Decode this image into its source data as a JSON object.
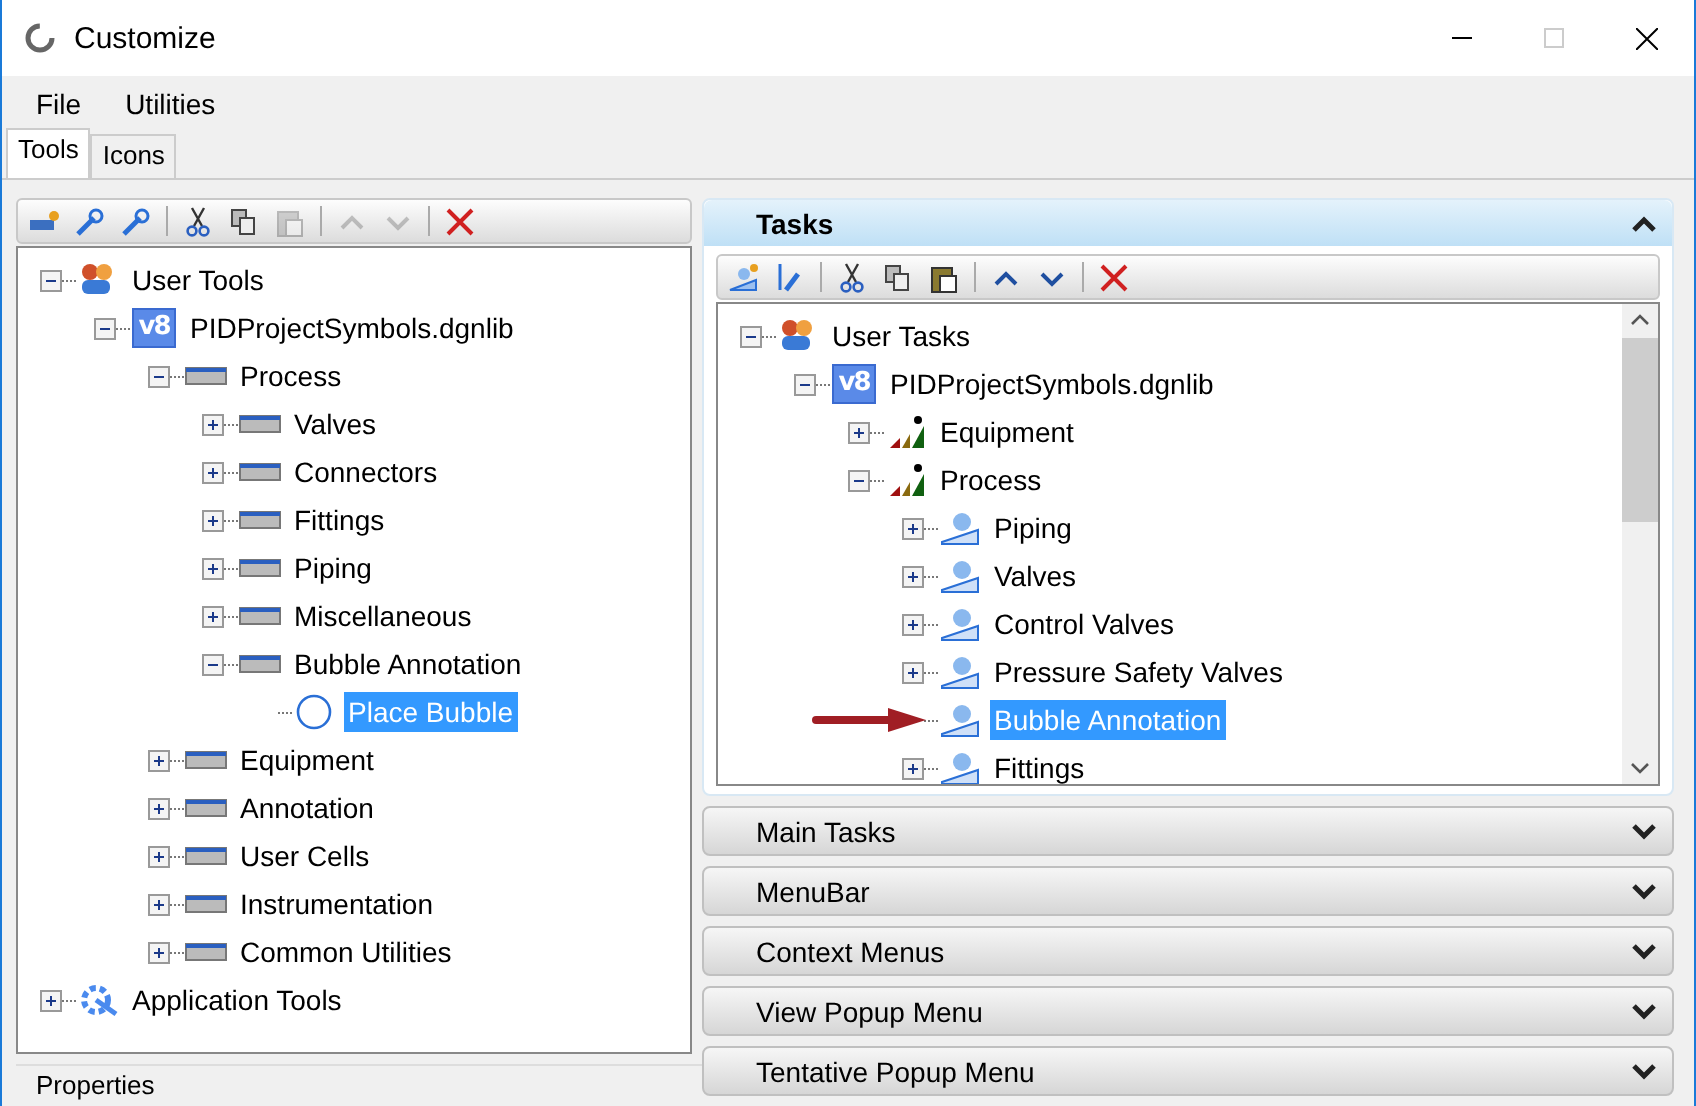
{
  "window": {
    "title": "Customize"
  },
  "menu": [
    "File",
    "Utilities"
  ],
  "tabs": [
    {
      "label": "Tools",
      "selected": true
    },
    {
      "label": "Icons",
      "selected": false
    }
  ],
  "tools_toolbar": [
    {
      "kind": "new",
      "disabled": false
    },
    {
      "kind": "new-tool",
      "disabled": false
    },
    {
      "kind": "rename",
      "disabled": false
    },
    {
      "kind": "separator"
    },
    {
      "kind": "cut",
      "disabled": false
    },
    {
      "kind": "copy",
      "disabled": false
    },
    {
      "kind": "paste",
      "disabled": true
    },
    {
      "kind": "separator"
    },
    {
      "kind": "up",
      "disabled": true
    },
    {
      "kind": "down",
      "disabled": true
    },
    {
      "kind": "separator"
    },
    {
      "kind": "delete",
      "disabled": false
    }
  ],
  "tools_tree": [
    {
      "label": "User Tools",
      "kind": "user-tools",
      "expanded": true,
      "selected": false,
      "children": [
        {
          "label": "PIDProjectSymbols.dgnlib",
          "kind": "library",
          "badge": "v8",
          "expanded": true,
          "selected": false,
          "children": [
            {
              "label": "Process",
              "kind": "toolbox",
              "expanded": true,
              "selected": false,
              "children": [
                {
                  "label": "Valves",
                  "kind": "toolbox",
                  "expanded": false,
                  "selected": false
                },
                {
                  "label": "Connectors",
                  "kind": "toolbox",
                  "expanded": false,
                  "selected": false
                },
                {
                  "label": "Fittings",
                  "kind": "toolbox",
                  "expanded": false,
                  "selected": false
                },
                {
                  "label": "Piping",
                  "kind": "toolbox",
                  "expanded": false,
                  "selected": false
                },
                {
                  "label": "Miscellaneous",
                  "kind": "toolbox",
                  "expanded": false,
                  "selected": false
                },
                {
                  "label": "Bubble Annotation",
                  "kind": "toolbox",
                  "expanded": true,
                  "selected": false,
                  "children": [
                    {
                      "label": "Place Bubble",
                      "kind": "tool",
                      "selected": true
                    }
                  ]
                }
              ]
            },
            {
              "label": "Equipment",
              "kind": "toolbox",
              "expanded": false,
              "selected": false
            },
            {
              "label": "Annotation",
              "kind": "toolbox",
              "expanded": false,
              "selected": false
            },
            {
              "label": "User Cells",
              "kind": "toolbox",
              "expanded": false,
              "selected": false
            },
            {
              "label": "Instrumentation",
              "kind": "toolbox",
              "expanded": false,
              "selected": false
            },
            {
              "label": "Common Utilities",
              "kind": "toolbox",
              "expanded": false,
              "selected": false
            }
          ]
        }
      ]
    },
    {
      "label": "Application Tools",
      "kind": "app-tools",
      "expanded": false,
      "selected": false
    }
  ],
  "sections": [
    {
      "title": "Tasks",
      "expanded": true,
      "toolbar": [
        {
          "kind": "new-task",
          "disabled": false
        },
        {
          "kind": "rename",
          "disabled": false
        },
        {
          "kind": "separator"
        },
        {
          "kind": "cut",
          "disabled": false
        },
        {
          "kind": "copy",
          "disabled": false
        },
        {
          "kind": "paste",
          "disabled": false
        },
        {
          "kind": "separator"
        },
        {
          "kind": "up",
          "disabled": false
        },
        {
          "kind": "down",
          "disabled": false
        },
        {
          "kind": "separator"
        },
        {
          "kind": "delete",
          "disabled": false
        }
      ],
      "tree": [
        {
          "label": "User Tasks",
          "kind": "user-tasks",
          "expanded": true,
          "selected": false,
          "children": [
            {
              "label": "PIDProjectSymbols.dgnlib",
              "kind": "library",
              "badge": "v8",
              "expanded": true,
              "selected": false,
              "children": [
                {
                  "label": "Equipment",
                  "kind": "task-group",
                  "expanded": false,
                  "selected": false
                },
                {
                  "label": "Process",
                  "kind": "task-group",
                  "expanded": true,
                  "selected": false,
                  "children": [
                    {
                      "label": "Piping",
                      "kind": "task",
                      "expanded": false,
                      "selected": false
                    },
                    {
                      "label": "Valves",
                      "kind": "task",
                      "expanded": false,
                      "selected": false
                    },
                    {
                      "label": "Control Valves",
                      "kind": "task",
                      "expanded": false,
                      "selected": false
                    },
                    {
                      "label": "Pressure Safety Valves",
                      "kind": "task",
                      "expanded": false,
                      "selected": false
                    },
                    {
                      "label": "Bubble Annotation",
                      "kind": "task",
                      "selected": true,
                      "pointer_arrow": true
                    },
                    {
                      "label": "Fittings",
                      "kind": "task",
                      "expanded": false,
                      "selected": false
                    }
                  ]
                }
              ]
            }
          ]
        }
      ]
    },
    {
      "title": "Main Tasks",
      "expanded": false
    },
    {
      "title": "MenuBar",
      "expanded": false
    },
    {
      "title": "Context Menus",
      "expanded": false
    },
    {
      "title": "View Popup Menu",
      "expanded": false
    },
    {
      "title": "Tentative Popup Menu",
      "expanded": false
    }
  ],
  "bottom_panel": {
    "title": "Properties"
  }
}
